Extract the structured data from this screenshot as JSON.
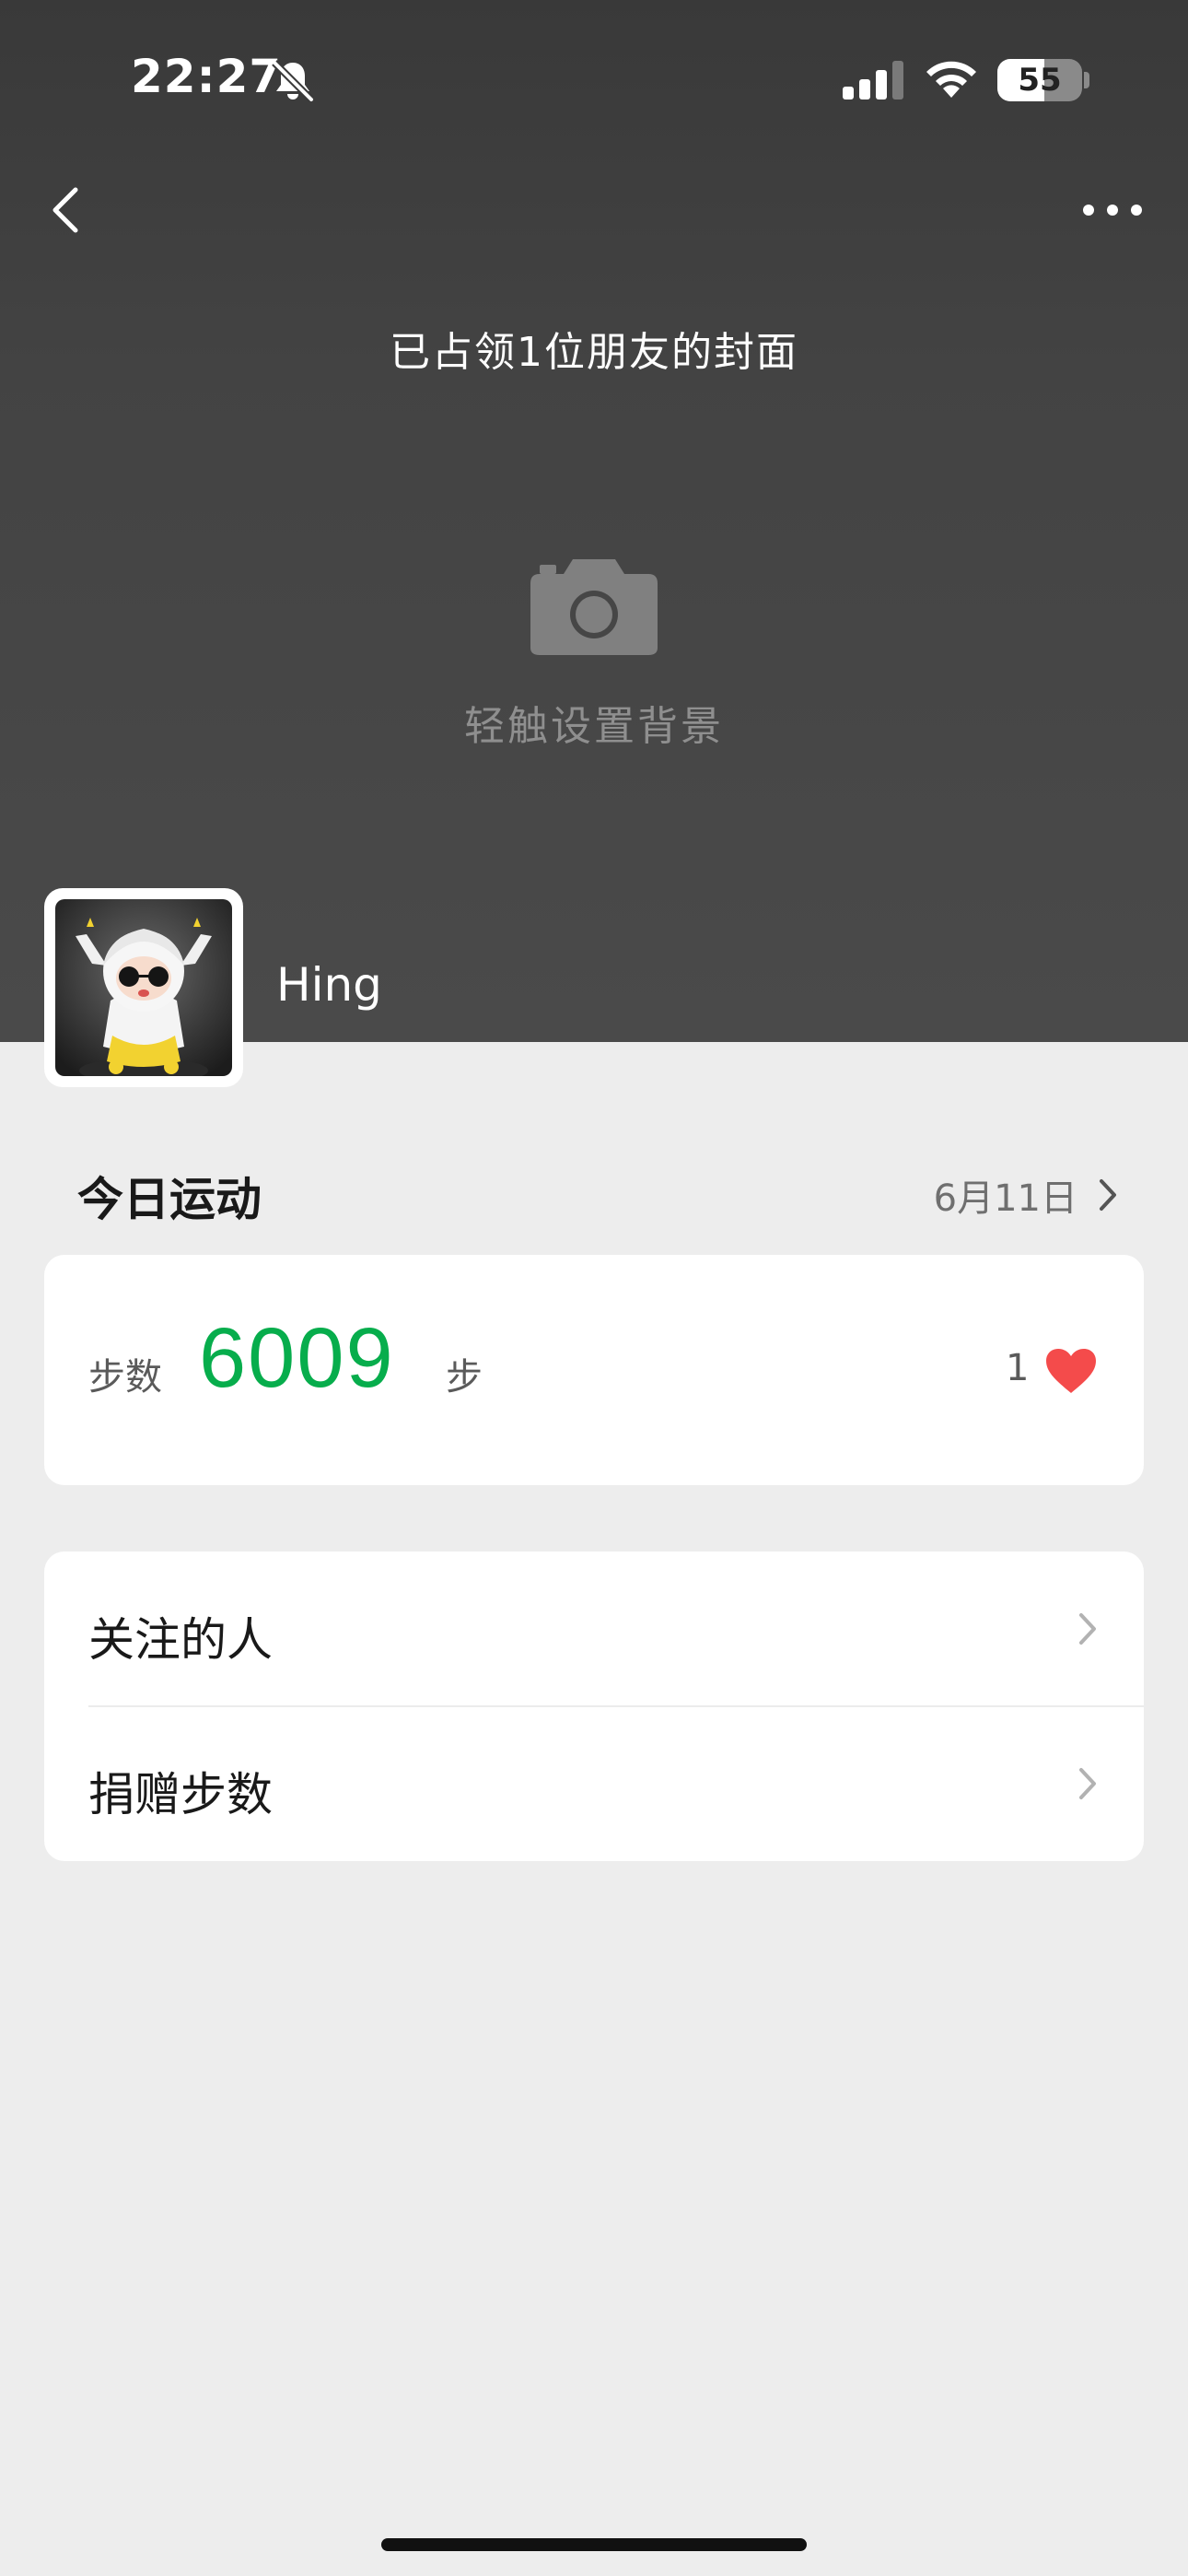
{
  "status_bar": {
    "time": "22:27",
    "battery_text": "55",
    "battery_level": 0.55,
    "icons": [
      "bell-slash-icon",
      "signal-icon",
      "wifi-icon",
      "battery-icon"
    ]
  },
  "cover": {
    "caption": "已占领1位朋友的封面",
    "set_background_text": "轻触设置背景",
    "username": "Hing",
    "icons": [
      "chevron-left-icon",
      "more-icon",
      "camera-icon"
    ]
  },
  "today": {
    "title": "今日运动",
    "date": "6月11日",
    "steps_label": "步数",
    "steps_value": "6009",
    "steps_unit": "步",
    "likes": "1"
  },
  "menu": {
    "items": [
      {
        "label": "关注的人"
      },
      {
        "label": "捐赠步数"
      }
    ]
  },
  "colors": {
    "accent_green": "#07ad4c",
    "heart_red": "#f44b4b",
    "page_background": "#ededed",
    "cover_background": "#434343"
  }
}
